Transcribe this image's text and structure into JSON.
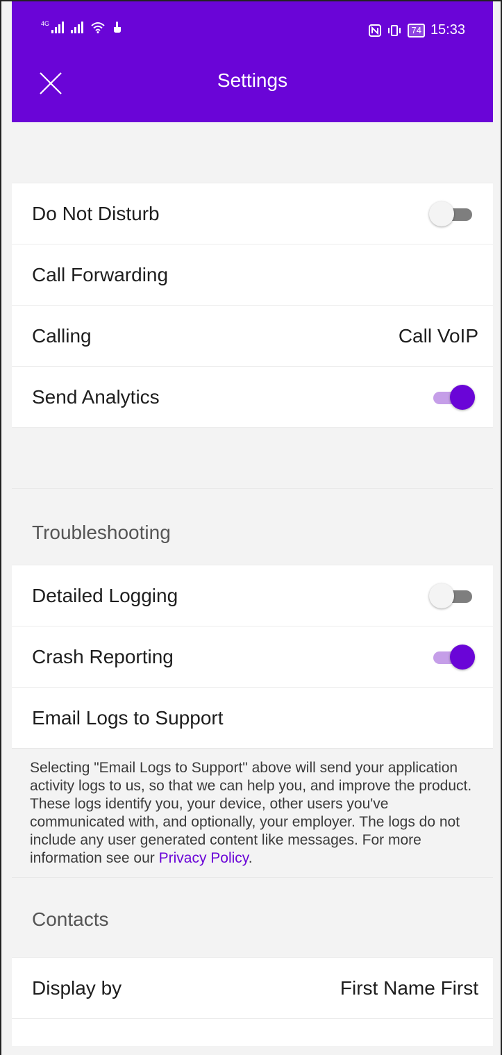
{
  "status_bar": {
    "network_type": "4G",
    "time": "15:33",
    "battery": "74"
  },
  "header": {
    "title": "Settings"
  },
  "rows": {
    "do_not_disturb": {
      "label": "Do Not Disturb",
      "enabled": false
    },
    "call_forwarding": {
      "label": "Call Forwarding"
    },
    "calling": {
      "label": "Calling",
      "value": "Call VoIP"
    },
    "send_analytics": {
      "label": "Send Analytics",
      "enabled": true
    }
  },
  "troubleshooting": {
    "header": "Troubleshooting",
    "detailed_logging": {
      "label": "Detailed Logging",
      "enabled": false
    },
    "crash_reporting": {
      "label": "Crash Reporting",
      "enabled": true
    },
    "email_logs": {
      "label": "Email Logs to Support"
    },
    "info_text": "Selecting \"Email Logs to Support\" above will send your application activity logs to us, so that we can help you, and improve the product. These logs identify you, your device, other users you've communicated with, and optionally, your employer. The logs do not include any user generated content like messages. For more information see our ",
    "privacy_link": "Privacy Policy",
    "info_suffix": "."
  },
  "contacts": {
    "header": "Contacts",
    "display_by": {
      "label": "Display by",
      "value": "First Name First"
    }
  },
  "colors": {
    "brand_purple": "#6a05d7",
    "toggle_on_track": "#c59ee8",
    "toggle_off_track": "#7e7e7e"
  }
}
